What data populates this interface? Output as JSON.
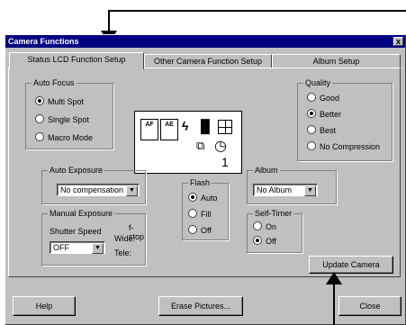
{
  "window": {
    "title": "Camera Functions",
    "close_label": "x"
  },
  "tabs": [
    "Status LCD Function Setup",
    "Other Camera Function Setup",
    "Album Setup"
  ],
  "auto_focus": {
    "label": "Auto Focus",
    "options": [
      "Multi Spot",
      "Single Spot",
      "Macro Mode"
    ],
    "selected": "Multi Spot"
  },
  "lcd": {
    "af": "AF",
    "ae": "AE",
    "flash_glyph": "ϟ",
    "quality_glyph": "▐▌",
    "timer_glyph": "◷",
    "frame_glyph": "⧉",
    "digits": "1"
  },
  "quality": {
    "label": "Quality",
    "options": [
      "Good",
      "Better",
      "Best",
      "No Compression"
    ],
    "selected": "Better"
  },
  "auto_exposure": {
    "label": "Auto Exposure",
    "value": "No compensation"
  },
  "flash": {
    "label": "Flash",
    "options": [
      "Auto",
      "Fill",
      "Off"
    ],
    "selected": "Auto"
  },
  "album": {
    "label": "Album",
    "value": "No Album"
  },
  "manual_exposure": {
    "label": "Manual Exposure",
    "shutter_label": "Shutter Speed",
    "shutter_value": "OFF",
    "fstop_label": "f-stop",
    "wide_label": "Wide:",
    "tele_label": "Tele:"
  },
  "self_timer": {
    "label": "Self-Timer",
    "options": [
      "On",
      "Off"
    ],
    "selected": "Off"
  },
  "buttons": {
    "update": "Update Camera",
    "help": "Help",
    "erase": "Erase Pictures...",
    "close": "Close"
  }
}
